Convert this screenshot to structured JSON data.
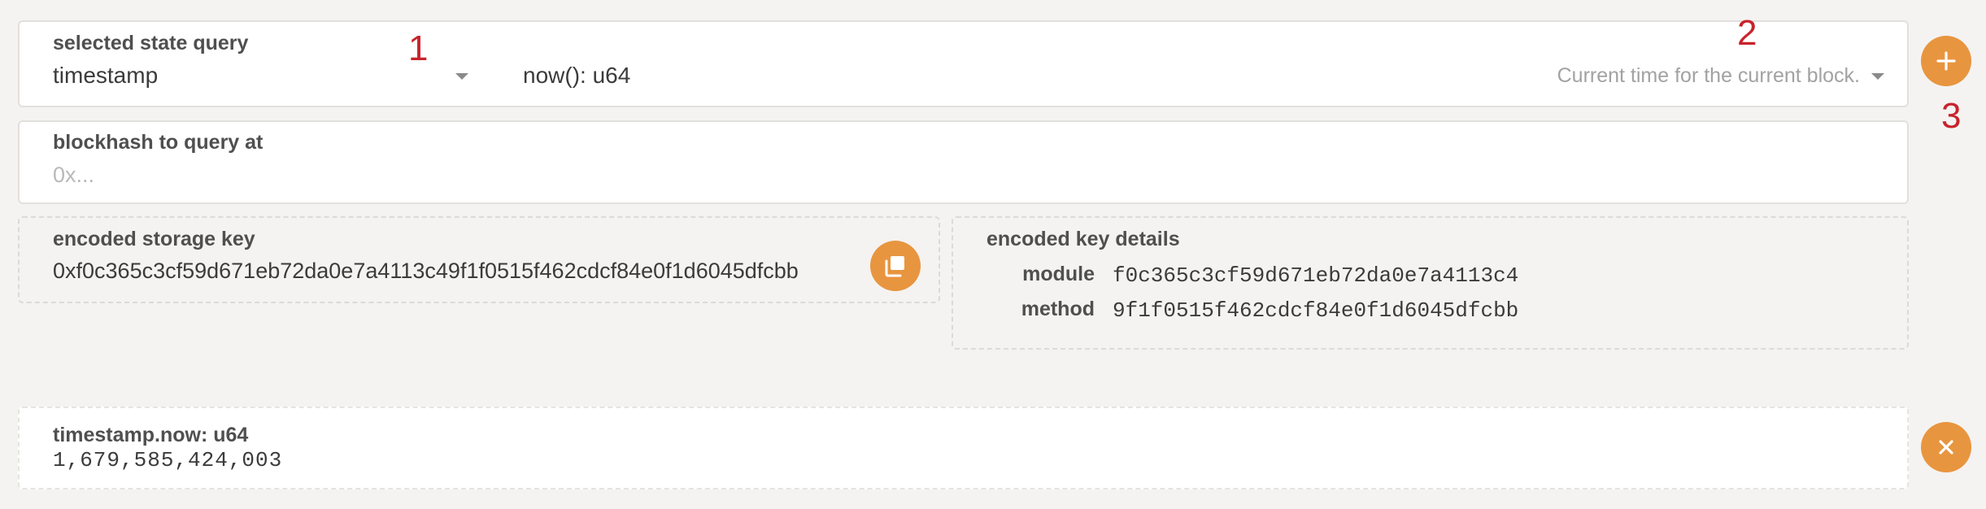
{
  "query": {
    "label": "selected state query",
    "selected_module": "timestamp",
    "method_signature": "now(): u64",
    "method_doc": "Current time for the current block."
  },
  "blockhash": {
    "label": "blockhash to query at",
    "placeholder": "0x..."
  },
  "storage_key": {
    "label": "encoded storage key",
    "value": "0xf0c365c3cf59d671eb72da0e7a4113c49f1f0515f462cdcf84e0f1d6045dfcbb"
  },
  "key_details": {
    "label": "encoded key details",
    "module_label": "module",
    "module_value": "f0c365c3cf59d671eb72da0e7a4113c4",
    "method_label": "method",
    "method_value": "9f1f0515f462cdcf84e0f1d6045dfcbb"
  },
  "result": {
    "label": "timestamp.now: u64",
    "value": "1,679,585,424,003"
  },
  "annotations": {
    "one": "1",
    "two": "2",
    "three": "3"
  },
  "colors": {
    "accent": "#e8953f",
    "annotation": "#c8232c"
  },
  "icons": {
    "add": "plus-icon",
    "remove": "close-icon",
    "copy": "copy-icon",
    "dropdown": "chevron-down-icon"
  }
}
